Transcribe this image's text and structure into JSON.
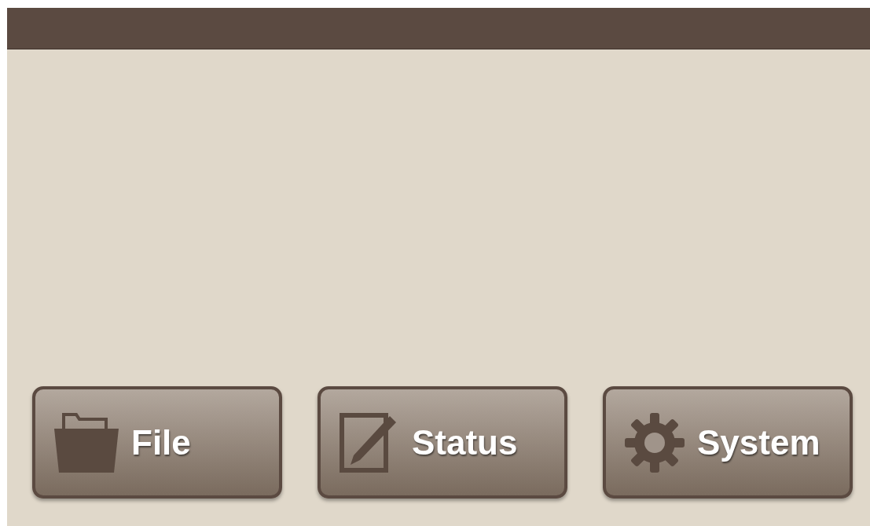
{
  "buttons": [
    {
      "label": "File",
      "kind": "folder"
    },
    {
      "label": "Status",
      "kind": "edit"
    },
    {
      "label": "System",
      "kind": "gear"
    }
  ]
}
